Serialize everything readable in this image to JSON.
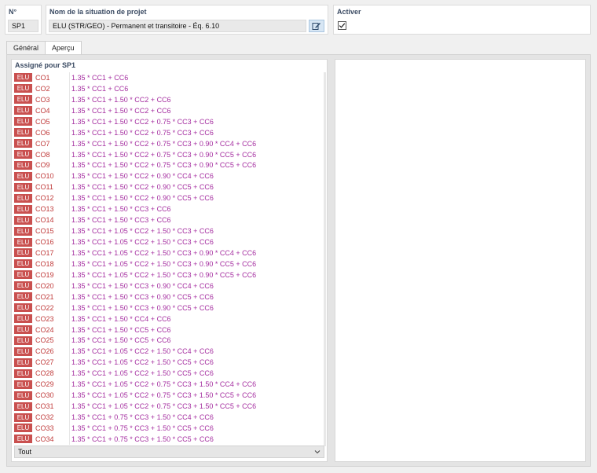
{
  "header": {
    "number_label": "N°",
    "number_value": "SP1",
    "name_label": "Nom de la situation de projet",
    "name_value": "ELU (STR/GEO) - Permanent et transitoire - Éq. 6.10",
    "activate_label": "Activer",
    "activate_checked": true
  },
  "tabs": [
    {
      "label": "Général",
      "active": false
    },
    {
      "label": "Aperçu",
      "active": true
    }
  ],
  "assigned": {
    "title": "Assigné pour SP1",
    "rows": [
      {
        "badge": "ELU",
        "code": "CO1",
        "formula": "1.35 * CC1 + CC6"
      },
      {
        "badge": "ELU",
        "code": "CO2",
        "formula": "1.35 * CC1 + CC6"
      },
      {
        "badge": "ELU",
        "code": "CO3",
        "formula": "1.35 * CC1 + 1.50 * CC2 + CC6"
      },
      {
        "badge": "ELU",
        "code": "CO4",
        "formula": "1.35 * CC1 + 1.50 * CC2 + CC6"
      },
      {
        "badge": "ELU",
        "code": "CO5",
        "formula": "1.35 * CC1 + 1.50 * CC2 + 0.75 * CC3 + CC6"
      },
      {
        "badge": "ELU",
        "code": "CO6",
        "formula": "1.35 * CC1 + 1.50 * CC2 + 0.75 * CC3 + CC6"
      },
      {
        "badge": "ELU",
        "code": "CO7",
        "formula": "1.35 * CC1 + 1.50 * CC2 + 0.75 * CC3 + 0.90 * CC4 + CC6"
      },
      {
        "badge": "ELU",
        "code": "CO8",
        "formula": "1.35 * CC1 + 1.50 * CC2 + 0.75 * CC3 + 0.90 * CC5 + CC6"
      },
      {
        "badge": "ELU",
        "code": "CO9",
        "formula": "1.35 * CC1 + 1.50 * CC2 + 0.75 * CC3 + 0.90 * CC5 + CC6"
      },
      {
        "badge": "ELU",
        "code": "CO10",
        "formula": "1.35 * CC1 + 1.50 * CC2 + 0.90 * CC4 + CC6"
      },
      {
        "badge": "ELU",
        "code": "CO11",
        "formula": "1.35 * CC1 + 1.50 * CC2 + 0.90 * CC5 + CC6"
      },
      {
        "badge": "ELU",
        "code": "CO12",
        "formula": "1.35 * CC1 + 1.50 * CC2 + 0.90 * CC5 + CC6"
      },
      {
        "badge": "ELU",
        "code": "CO13",
        "formula": "1.35 * CC1 + 1.50 * CC3 + CC6"
      },
      {
        "badge": "ELU",
        "code": "CO14",
        "formula": "1.35 * CC1 + 1.50 * CC3 + CC6"
      },
      {
        "badge": "ELU",
        "code": "CO15",
        "formula": "1.35 * CC1 + 1.05 * CC2 + 1.50 * CC3 + CC6"
      },
      {
        "badge": "ELU",
        "code": "CO16",
        "formula": "1.35 * CC1 + 1.05 * CC2 + 1.50 * CC3 + CC6"
      },
      {
        "badge": "ELU",
        "code": "CO17",
        "formula": "1.35 * CC1 + 1.05 * CC2 + 1.50 * CC3 + 0.90 * CC4 + CC6"
      },
      {
        "badge": "ELU",
        "code": "CO18",
        "formula": "1.35 * CC1 + 1.05 * CC2 + 1.50 * CC3 + 0.90 * CC5 + CC6"
      },
      {
        "badge": "ELU",
        "code": "CO19",
        "formula": "1.35 * CC1 + 1.05 * CC2 + 1.50 * CC3 + 0.90 * CC5 + CC6"
      },
      {
        "badge": "ELU",
        "code": "CO20",
        "formula": "1.35 * CC1 + 1.50 * CC3 + 0.90 * CC4 + CC6"
      },
      {
        "badge": "ELU",
        "code": "CO21",
        "formula": "1.35 * CC1 + 1.50 * CC3 + 0.90 * CC5 + CC6"
      },
      {
        "badge": "ELU",
        "code": "CO22",
        "formula": "1.35 * CC1 + 1.50 * CC3 + 0.90 * CC5 + CC6"
      },
      {
        "badge": "ELU",
        "code": "CO23",
        "formula": "1.35 * CC1 + 1.50 * CC4 + CC6"
      },
      {
        "badge": "ELU",
        "code": "CO24",
        "formula": "1.35 * CC1 + 1.50 * CC5 + CC6"
      },
      {
        "badge": "ELU",
        "code": "CO25",
        "formula": "1.35 * CC1 + 1.50 * CC5 + CC6"
      },
      {
        "badge": "ELU",
        "code": "CO26",
        "formula": "1.35 * CC1 + 1.05 * CC2 + 1.50 * CC4 + CC6"
      },
      {
        "badge": "ELU",
        "code": "CO27",
        "formula": "1.35 * CC1 + 1.05 * CC2 + 1.50 * CC5 + CC6"
      },
      {
        "badge": "ELU",
        "code": "CO28",
        "formula": "1.35 * CC1 + 1.05 * CC2 + 1.50 * CC5 + CC6"
      },
      {
        "badge": "ELU",
        "code": "CO29",
        "formula": "1.35 * CC1 + 1.05 * CC2 + 0.75 * CC3 + 1.50 * CC4 + CC6"
      },
      {
        "badge": "ELU",
        "code": "CO30",
        "formula": "1.35 * CC1 + 1.05 * CC2 + 0.75 * CC3 + 1.50 * CC5 + CC6"
      },
      {
        "badge": "ELU",
        "code": "CO31",
        "formula": "1.35 * CC1 + 1.05 * CC2 + 0.75 * CC3 + 1.50 * CC5 + CC6"
      },
      {
        "badge": "ELU",
        "code": "CO32",
        "formula": "1.35 * CC1 + 0.75 * CC3 + 1.50 * CC4 + CC6"
      },
      {
        "badge": "ELU",
        "code": "CO33",
        "formula": "1.35 * CC1 + 0.75 * CC3 + 1.50 * CC5 + CC6"
      },
      {
        "badge": "ELU",
        "code": "CO34",
        "formula": "1.35 * CC1 + 0.75 * CC3 + 1.50 * CC5 + CC6"
      }
    ]
  },
  "filter": {
    "selected": "Tout"
  },
  "icons": {
    "edit": "edit-icon",
    "check": "check-icon",
    "dropdown": "chevron-down-icon"
  },
  "colors": {
    "badge": "#c9504f",
    "code": "#c03a3a",
    "formula": "#a52ea0",
    "header_label": "#3b4b63"
  }
}
